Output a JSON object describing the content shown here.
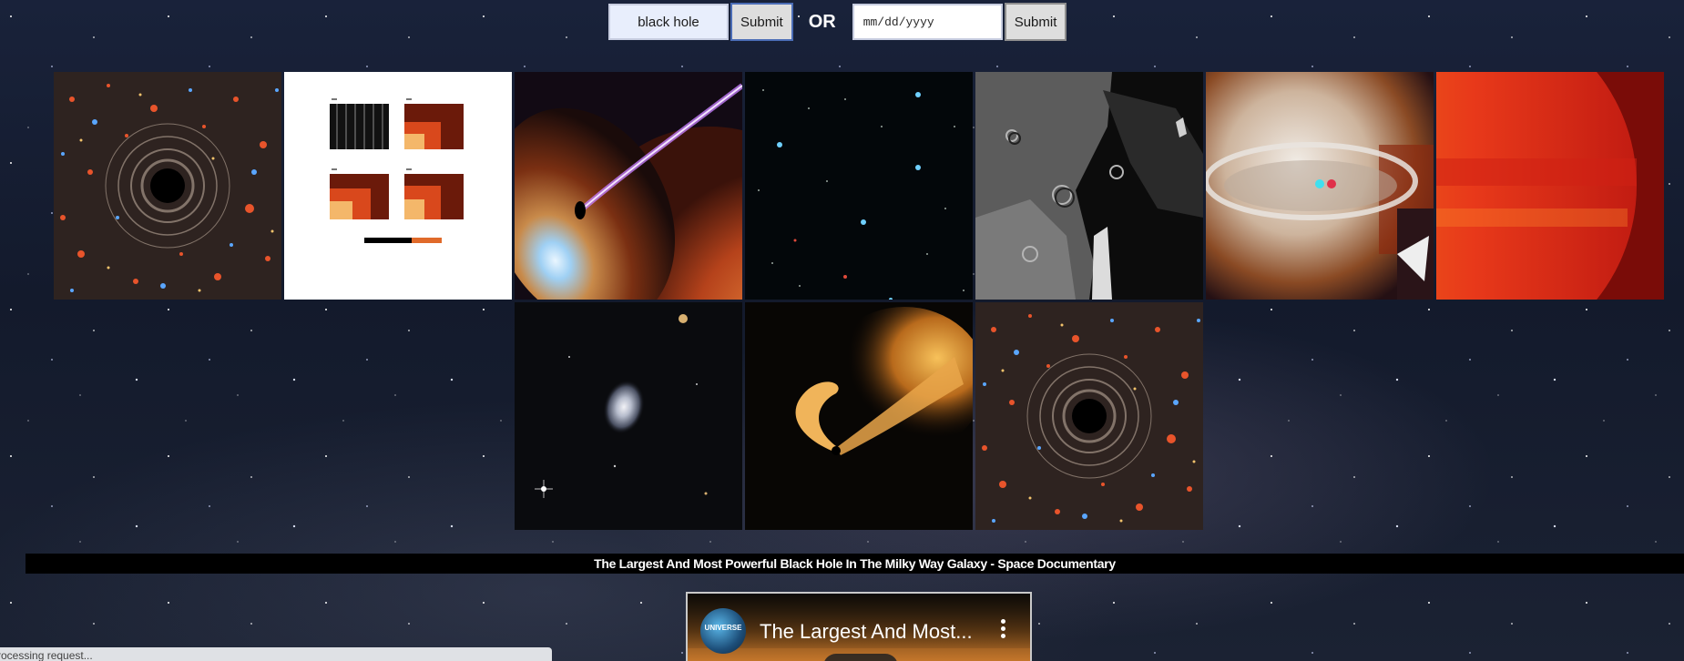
{
  "search": {
    "query_value": "black hole",
    "date_placeholder": "mm/dd/yyyy",
    "submit_label": "Submit",
    "or_label": "OR"
  },
  "gallery": {
    "images": [
      {
        "subject": "black hole against dense star field"
      },
      {
        "subject": "four-panel simulation plot figure"
      },
      {
        "subject": "black hole accretion disk with jet"
      },
      {
        "subject": "sparse star field"
      },
      {
        "subject": "cratered grey planetary surface"
      },
      {
        "subject": "translucent disk simulation render"
      },
      {
        "subject": "red-orange star surface"
      },
      {
        "subject": "spiral galaxy"
      },
      {
        "subject": "tidal disruption event"
      },
      {
        "subject": "black hole against dense star field"
      }
    ]
  },
  "video": {
    "heading": "The Largest And Most Powerful Black Hole In The Milky Way Galaxy - Space Documentary",
    "embed_title": "The Largest And Most...",
    "channel_avatar_text": "UNIVERSE"
  },
  "status": {
    "text": "Processing request..."
  },
  "colors": {
    "page_background": "#141b2c",
    "title_bar": "#000000",
    "accent_border": "#4b6db6"
  }
}
